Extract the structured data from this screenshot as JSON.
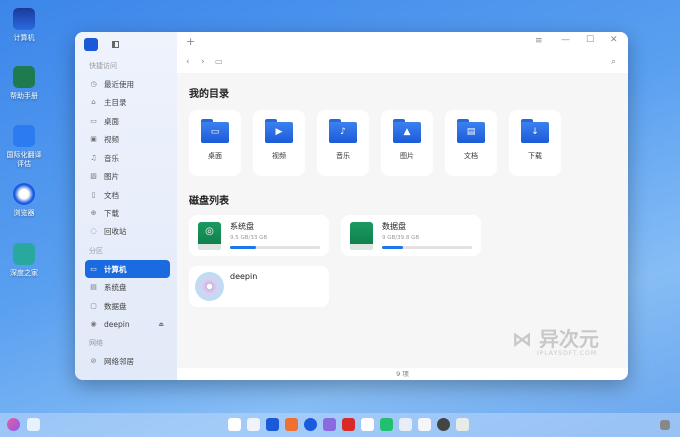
{
  "desktop": {
    "icons": [
      {
        "label": "计算机"
      },
      {
        "label": "帮助手册"
      },
      {
        "label": "国际化翻译评估"
      },
      {
        "label": "浏览器"
      },
      {
        "label": "深度之家"
      }
    ]
  },
  "sidebar": {
    "sections": {
      "quick": "快捷访问",
      "partitions": "分区",
      "network": "网络"
    },
    "items": [
      {
        "label": "最近使用",
        "icon": "clock-icon"
      },
      {
        "label": "主目录",
        "icon": "home-icon"
      },
      {
        "label": "桌面",
        "icon": "desktop-icon"
      },
      {
        "label": "视频",
        "icon": "video-icon"
      },
      {
        "label": "音乐",
        "icon": "music-icon"
      },
      {
        "label": "图片",
        "icon": "picture-icon"
      },
      {
        "label": "文档",
        "icon": "document-icon"
      },
      {
        "label": "下载",
        "icon": "download-icon"
      },
      {
        "label": "回收站",
        "icon": "trash-icon"
      }
    ],
    "partitions": [
      {
        "label": "计算机"
      },
      {
        "label": "系统盘"
      },
      {
        "label": "数据盘"
      },
      {
        "label": "deepin"
      }
    ],
    "network_items": [
      {
        "label": "网络邻居"
      }
    ]
  },
  "main": {
    "my_dirs_title": "我的目录",
    "folders": [
      {
        "label": "桌面"
      },
      {
        "label": "视频"
      },
      {
        "label": "音乐"
      },
      {
        "label": "图片"
      },
      {
        "label": "文档"
      },
      {
        "label": "下载"
      }
    ],
    "disks_title": "磁盘列表",
    "disks": [
      {
        "name": "系统盘",
        "size": "9.5 GB/33 GB",
        "usage": 0.29
      },
      {
        "name": "数据盘",
        "size": "9 GB/39.8 GB",
        "usage": 0.23
      }
    ],
    "optical": {
      "name": "deepin"
    },
    "status": "9 项"
  },
  "watermark": {
    "brand": "异次元",
    "site": "IPLAYSOFT.COM"
  },
  "colors": {
    "accent": "#1a6ae0",
    "disk_green": "#1c9a60"
  }
}
